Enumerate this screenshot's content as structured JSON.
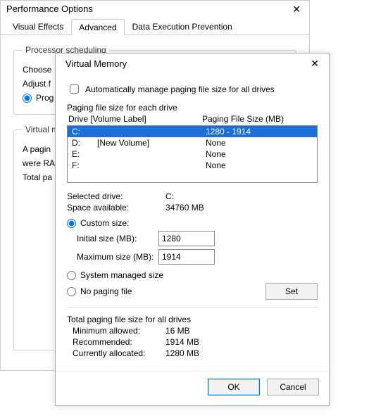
{
  "perf": {
    "title": "Performance Options",
    "tabs": {
      "visual": "Visual Effects",
      "advanced": "Advanced",
      "dep": "Data Execution Prevention"
    },
    "proc_legend": "Processor scheduling",
    "choose": "Choose",
    "adjust": "Adjust f",
    "programs": "Prog",
    "vm_legend": "Virtual m",
    "vm_desc1": "A pagin",
    "vm_desc2": "were RA",
    "total": "Total pa"
  },
  "vm": {
    "title": "Virtual Memory",
    "auto_label": "Automatically manage paging file size for all drives",
    "section1": "Paging file size for each drive",
    "head_drive": "Drive  [Volume Label]",
    "head_size": "Paging File Size (MB)",
    "drives": [
      {
        "d": "C:",
        "label": "",
        "size": "1280 - 1914",
        "sel": true
      },
      {
        "d": "D:",
        "label": "[New Volume]",
        "size": "None",
        "sel": false
      },
      {
        "d": "E:",
        "label": "",
        "size": "None",
        "sel": false
      },
      {
        "d": "F:",
        "label": "",
        "size": "None",
        "sel": false
      }
    ],
    "selected_drive_k": "Selected drive:",
    "selected_drive_v": "C:",
    "space_k": "Space available:",
    "space_v": "34760 MB",
    "custom": "Custom size:",
    "initial_k": "Initial size (MB):",
    "initial_v": "1280",
    "max_k": "Maximum size (MB):",
    "max_v": "1914",
    "sys_managed": "System managed size",
    "no_paging": "No paging file",
    "set": "Set",
    "totals_title": "Total paging file size for all drives",
    "min_k": "Minimum allowed:",
    "min_v": "16 MB",
    "rec_k": "Recommended:",
    "rec_v": "1914 MB",
    "cur_k": "Currently allocated:",
    "cur_v": "1280 MB",
    "ok": "OK",
    "cancel": "Cancel"
  }
}
